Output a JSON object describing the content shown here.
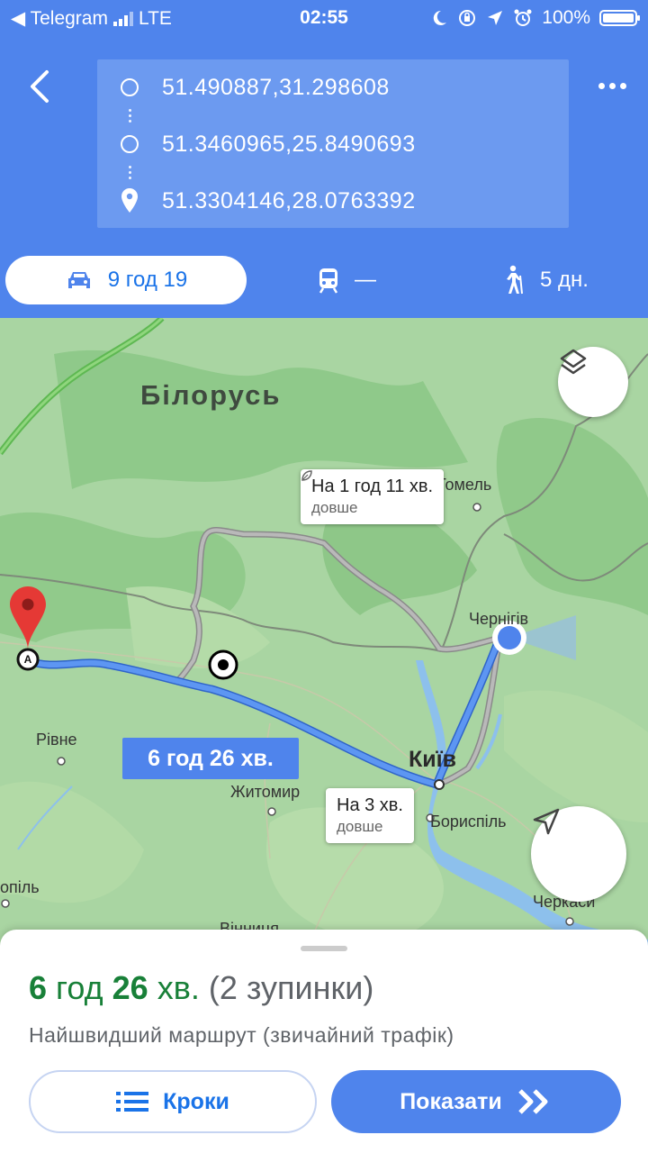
{
  "status_bar": {
    "back_app": "◀ Telegram",
    "network": "LTE",
    "time": "02:55",
    "battery": "100%",
    "battery_level": 1.0
  },
  "waypoints": [
    {
      "value": "51.490887,31.298608",
      "icon": "circle-icon"
    },
    {
      "value": "51.3460965,25.8490693",
      "icon": "circle-icon"
    },
    {
      "value": "51.3304146,28.0763392",
      "icon": "destination-pin-icon"
    }
  ],
  "modes": {
    "car": {
      "label": "9 год 19",
      "icon": "car-icon",
      "active": true
    },
    "transit": {
      "label": "—",
      "icon": "train-icon"
    },
    "walk": {
      "label": "5 дн.",
      "icon": "walk-icon"
    }
  },
  "map": {
    "labels": {
      "belarus": "Білорусь",
      "gomel": "Гомель",
      "chernihiv": "Чернігів",
      "kyiv": "Київ",
      "rivne": "Рівне",
      "zhytomyr": "Житомир",
      "boryspil": "Бориспіль",
      "ternopil": "опіль",
      "cherkasy": "Черкаси",
      "vinnytsia": "Вінниця"
    },
    "marker_a": "A",
    "route_label": "6 год 26 хв.",
    "alt_route_1": {
      "title": "На 1 год 11 хв.",
      "subtitle": "довше"
    },
    "alt_route_2": {
      "title": "На 3 хв.",
      "subtitle": "довше"
    },
    "colors": {
      "route": "#4f84ec",
      "alt_route": "#9e9e9e",
      "highway": "#6cc24a",
      "water": "#7fb6e8"
    }
  },
  "sheet": {
    "eta_hours": "6",
    "eta_hours_unit": "год",
    "eta_minutes": "26",
    "eta_minutes_unit": "хв.",
    "stops": "(2 зупинки)",
    "summary": "Найшвидший маршрут (звичайний трафік)",
    "steps_label": "Кроки",
    "start_label": "Показати"
  }
}
